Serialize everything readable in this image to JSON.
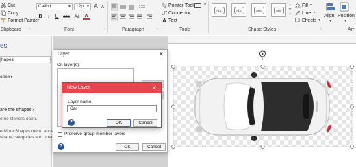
{
  "ribbon": {
    "clipboard": {
      "cut": "Cut",
      "copy": "Copy",
      "format_painter": "Format Painter",
      "group_label": "Clipboard"
    },
    "font": {
      "font_name": "Calibri",
      "font_size": "12pt.",
      "bold": "B",
      "italic": "I",
      "underline": "U",
      "strike": "abc",
      "grow": "A",
      "shrink": "A",
      "aa": "Aa",
      "color": "A",
      "group_label": "Font"
    },
    "paragraph": {
      "group_label": "Paragraph"
    },
    "tools": {
      "pointer_tool": "Pointer Tool",
      "connector": "Connector",
      "text": "Text",
      "group_label": "Tools"
    },
    "shape_styles": {
      "style_text": "Abc",
      "fill": "Fill",
      "line": "Line",
      "effects": "Effects",
      "group_label": "Shape Styles"
    },
    "arrange": {
      "align": "Align",
      "position": "Position",
      "group_label": "Arr"
    }
  },
  "left_pane": {
    "title": "es",
    "search_text": "hapes",
    "more_shapes": "apes",
    "question": "are the shapes?",
    "help_lines": [
      "e no stencils open.",
      "e More Shapes menu above t",
      "shape categories and open s"
    ]
  },
  "layer_dialog": {
    "title": "Layer",
    "close": "✕",
    "on_layers_label": "On layer(s):",
    "preserve_label": "Preserve group member layers",
    "ok": "OK",
    "cancel": "Cancel",
    "help": "?"
  },
  "new_layer_dialog": {
    "title": "New Layer",
    "close": "✕",
    "layer_name_label": "Layer name:",
    "layer_name_value": "Car",
    "ok": "OK",
    "cancel": "Cancel",
    "help": "?"
  },
  "colors": {
    "accent_red": "#e8464f",
    "dialog_border_red": "#d13438",
    "help_blue": "#2b579a",
    "pane_title_blue": "#2b5797"
  }
}
